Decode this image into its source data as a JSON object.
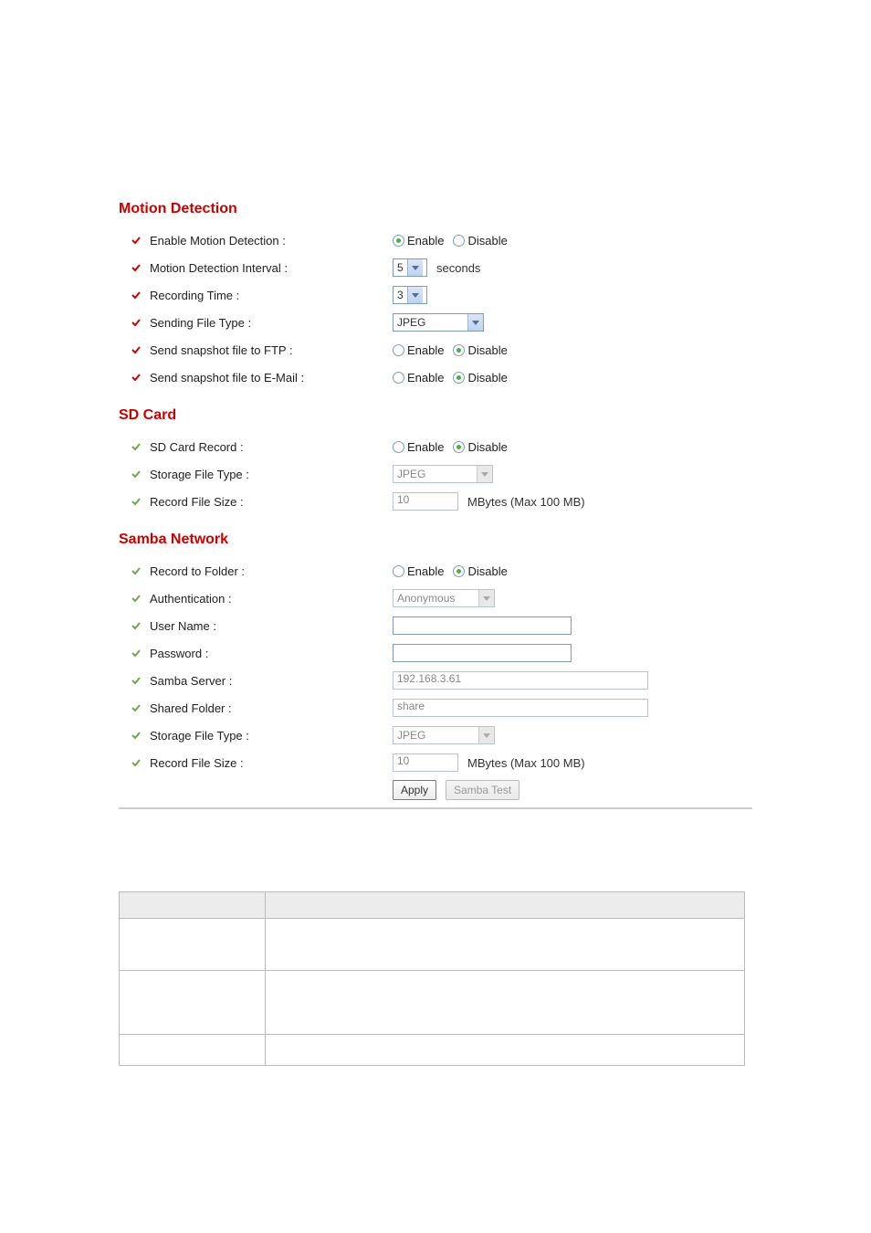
{
  "motion": {
    "title": "Motion Detection",
    "enable_label": "Enable Motion Detection :",
    "enable": {
      "opt_enable": "Enable",
      "opt_disable": "Disable",
      "value": "enable"
    },
    "interval_label": "Motion Detection Interval :",
    "interval_value": "5",
    "interval_unit": "seconds",
    "recording_time_label": "Recording Time :",
    "recording_time_value": "3",
    "sending_file_type_label": "Sending File Type :",
    "sending_file_type_value": "JPEG",
    "send_ftp_label": "Send snapshot file to FTP :",
    "send_ftp": {
      "opt_enable": "Enable",
      "opt_disable": "Disable",
      "value": "disable"
    },
    "send_email_label": "Send snapshot file to E-Mail :",
    "send_email": {
      "opt_enable": "Enable",
      "opt_disable": "Disable",
      "value": "disable"
    }
  },
  "sdcard": {
    "title": "SD Card",
    "record_label": "SD Card Record :",
    "record": {
      "opt_enable": "Enable",
      "opt_disable": "Disable",
      "value": "disable"
    },
    "storage_type_label": "Storage File Type :",
    "storage_type_value": "JPEG",
    "record_size_label": "Record File Size :",
    "record_size_value": "10",
    "record_size_unit": "MBytes (Max 100 MB)"
  },
  "samba": {
    "title": "Samba Network",
    "record_folder_label": "Record to Folder :",
    "record_folder": {
      "opt_enable": "Enable",
      "opt_disable": "Disable",
      "value": "disable"
    },
    "auth_label": "Authentication :",
    "auth_value": "Anonymous",
    "user_label": "User Name :",
    "user_value": "",
    "pass_label": "Password :",
    "pass_value": "",
    "server_label": "Samba Server :",
    "server_value": "192.168.3.61",
    "shared_label": "Shared Folder :",
    "shared_value": "share",
    "storage_type_label": "Storage File Type :",
    "storage_type_value": "JPEG",
    "record_size_label": "Record File Size :",
    "record_size_value": "10",
    "record_size_unit": "MBytes (Max 100 MB)",
    "apply_btn": "Apply",
    "samba_test_btn": "Samba Test"
  },
  "table": {
    "h1": "",
    "h2": "",
    "r1c1": "",
    "r1c2": "         '            '\n'            '",
    "r2c1": "",
    "r2c2": "",
    "r3c1": "",
    "r3c2": ""
  }
}
